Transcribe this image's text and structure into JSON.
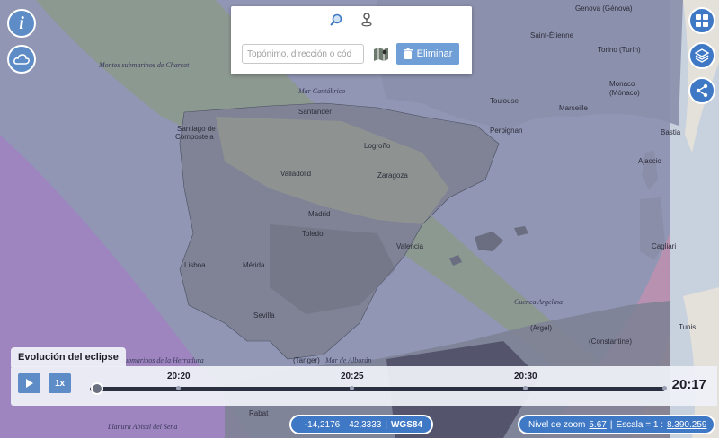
{
  "map_labels": {
    "charcot": "Montes submarinos de Charcot",
    "cantabrico": "Mar Cantábrico",
    "santander": "Santander",
    "santiago_1": "Santiago de",
    "santiago_2": "Compostela",
    "valladolid": "Valladolid",
    "zaragoza": "Zaragoza",
    "madrid": "Madrid",
    "toledo": "Toledo",
    "valencia": "Valencia",
    "lisboa": "Lisboa",
    "merida": "Mérida",
    "sevilla": "Sevilla",
    "logrono": "Logroño",
    "perpignan": "Perpignan",
    "toulouse": "Toulouse",
    "marseille": "Marseille",
    "monaco": "Monaco",
    "monaco_2": "(Mónaco)",
    "genova": "Genova (Génova)",
    "saint_etienne": "Saint-Étienne",
    "torino": "Torino (Turín)",
    "cuenca_argelina": "Cuenca Argelina",
    "herradura": "submarinos de la Herradura",
    "alboran": "Mar de Alborán",
    "abisal": "Llanura Abisal del Sena",
    "tunis": "Tunis",
    "cagliari": "Cagliari",
    "bastia": "Bastia",
    "ajaccio": "Ajaccio",
    "constantine": "(Constantine)",
    "rabat": "Rabat",
    "alger": "(Argel)",
    "tanger": "(Tanger)"
  },
  "search": {
    "placeholder": "Topónimo, dirección o cód",
    "value": "",
    "delete_label": "Eliminar"
  },
  "eclipse": {
    "title": "Evolución del eclipse",
    "speed_label": "1x",
    "ticks": [
      "20:20",
      "20:25",
      "20:30"
    ],
    "current_time": "20:17"
  },
  "coordinates": {
    "lon": "-14,2176",
    "lat": "42,3333",
    "crs": "WGS84"
  },
  "zoom": {
    "zoom_label": "Nivel de zoom",
    "zoom_value": "5.67",
    "scale_label": "Escala = 1 :",
    "scale_value": "8.390.259"
  },
  "colors": {
    "button_blue": "#3f78c4",
    "button_light_blue": "#5d8cc6",
    "eclipse_band_green": "#8da088",
    "eclipse_purple": "#a77fc7",
    "eclipse_orange": "#e9a07a"
  }
}
